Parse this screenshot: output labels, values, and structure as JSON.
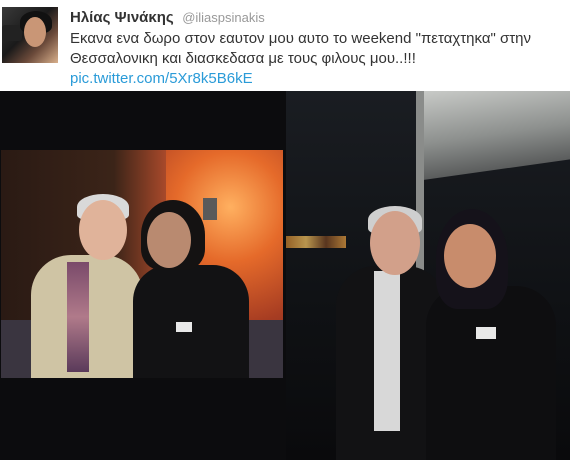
{
  "tweet": {
    "author_name": "Ηλίας Ψινάκης",
    "author_handle": "@iliaspsinakis",
    "text": "Εκανα ενα δωρο στον εαυτον μου αυτο το weekend \"πεταχτηκα\" στην Θεσσαλονικη και διασκεδασα με τους φιλους μου..!!!",
    "link": "pic.twitter.com/5Xr8k5B6kE"
  },
  "colors": {
    "author_text": "#333333",
    "handle_text": "#999999",
    "link": "#2a9bd8",
    "photo_background": "#0c0c0e"
  }
}
